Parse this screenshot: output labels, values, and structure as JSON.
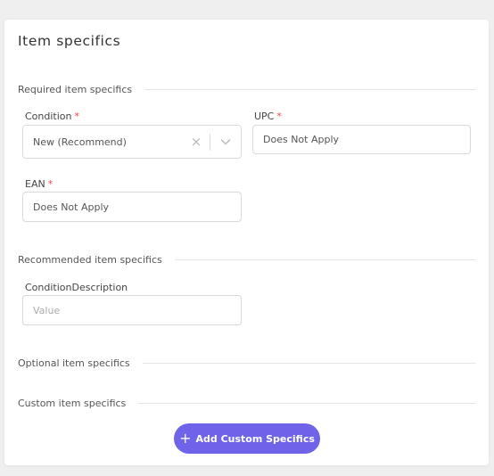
{
  "card": {
    "title": "Item specifics"
  },
  "sections": {
    "required": "Required item specifics",
    "recommended": "Recommended item specifics",
    "optional": "Optional item specifics",
    "custom": "Custom item specifics"
  },
  "fields": {
    "condition": {
      "label": "Condition",
      "required_mark": "*",
      "value": "New (Recommend)",
      "clear_icon": "×"
    },
    "upc": {
      "label": "UPC",
      "required_mark": "*",
      "value": "Does Not Apply"
    },
    "ean": {
      "label": "EAN",
      "required_mark": "*",
      "value": "Does Not Apply"
    },
    "condition_description": {
      "label": "ConditionDescription",
      "value": "",
      "placeholder": "Value"
    }
  },
  "actions": {
    "add_custom_label": "Add Custom Specifics",
    "add_icon": "+"
  },
  "colors": {
    "accent": "#6e63e9",
    "required": "#e5484d"
  }
}
